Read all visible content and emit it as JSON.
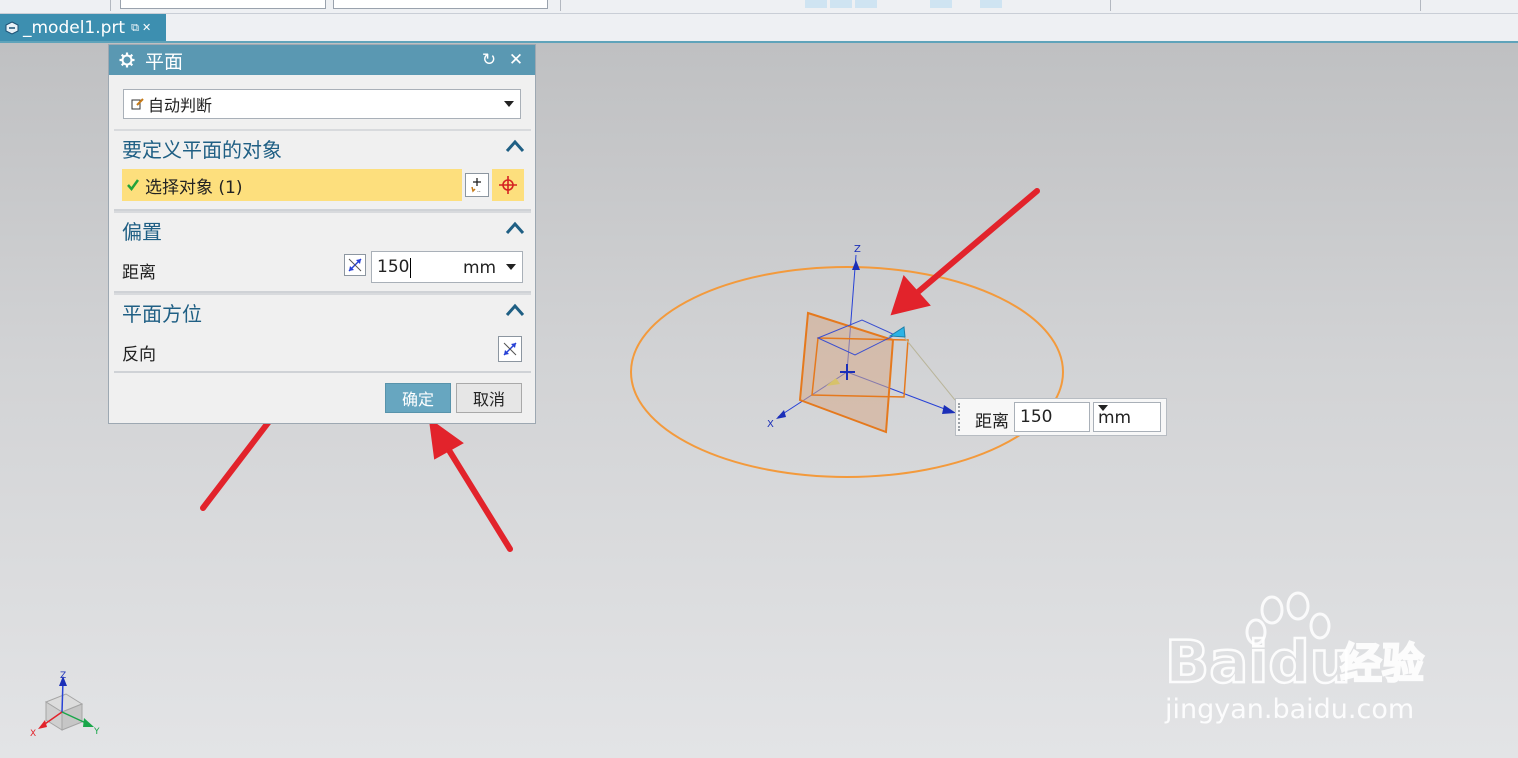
{
  "file_tab": {
    "name": "_model1.prt"
  },
  "dialog": {
    "title": "平面",
    "type_select": "自动判断",
    "sections": {
      "objects": {
        "header": "要定义平面的对象",
        "select_label": "选择对象 (1)"
      },
      "offset": {
        "header": "偏置",
        "distance_label": "距离",
        "distance_value": "150",
        "unit": "mm"
      },
      "orientation": {
        "header": "平面方位",
        "reverse_label": "反向"
      }
    },
    "ok_label": "确定",
    "cancel_label": "取消"
  },
  "screen_widget": {
    "label": "距离",
    "value": "150",
    "unit": "mm"
  },
  "axis_labels": {
    "x": "X",
    "y": "Y",
    "z": "Z"
  },
  "watermark": {
    "brand": "Baidu",
    "cn": "经验",
    "url": "jingyan.baidu.com"
  },
  "colors": {
    "dialog_title": "#5a98b2",
    "selection_highlight": "#fddf7d",
    "plane_outline": "#e5791d",
    "annotation_arrow": "#e2232b",
    "axis_blue": "#2741d6"
  },
  "icons": [
    "gear-icon",
    "reset-icon",
    "close-icon",
    "chevron-up-icon",
    "dropdown-arrow-icon",
    "check-icon",
    "crosshair-icon",
    "add-selection-icon",
    "reverse-direction-icon"
  ]
}
